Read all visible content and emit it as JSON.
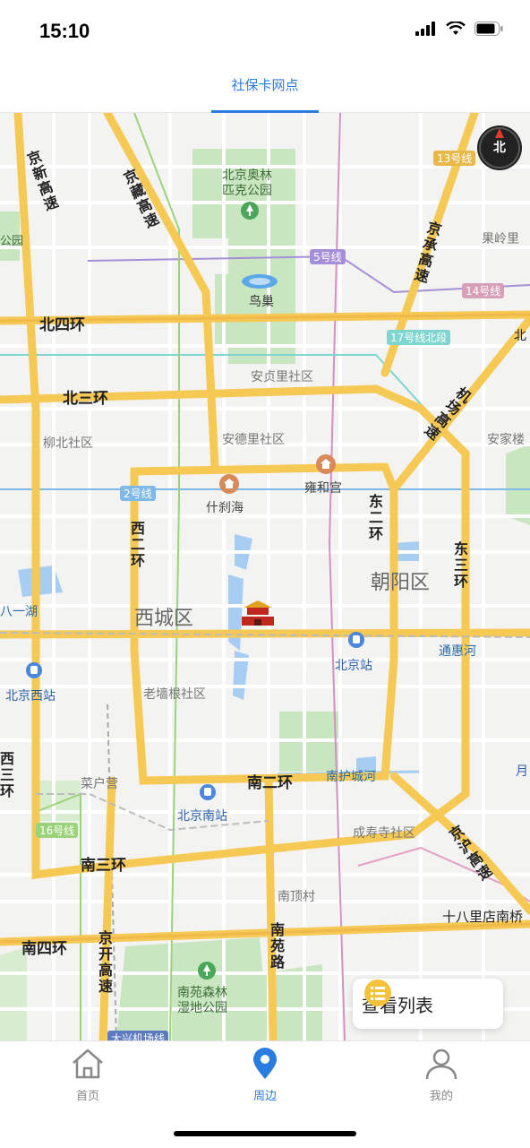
{
  "status_bar": {
    "time": "15:10"
  },
  "header": {
    "tab_label": "社保卡网点"
  },
  "map": {
    "colors": {
      "background": "#f3f3f1",
      "road_major": "#f6c955",
      "road_minor": "#ffffff",
      "park": "#c8e6c0",
      "water": "#a8cdf2"
    },
    "labels": {
      "olympic_park": "北京奥林\n匹克公园",
      "birds_nest": "鸟巢",
      "north_4th_ring": "北四环",
      "north_3rd_ring": "北三环",
      "andeli": "安德里社区",
      "anzhenli": "安贞里社区",
      "liubei": "柳北社区",
      "shichahai": "什刹海",
      "yonghegong": "雍和宫",
      "west_2nd_ring": "西二环",
      "east_2nd_ring": "东二环",
      "east_3rd_ring": "东三环",
      "xicheng": "西城区",
      "chaoyang": "朝阳区",
      "bayi_lake": "八一湖",
      "beijing_west": "北京西站",
      "beijing_station": "北京站",
      "tonghui_river": "通惠河",
      "laoqianggen": "老墙根社区",
      "caihuying": "菜户营",
      "south_2nd_ring": "南二环",
      "nanhu_river": "南护城河",
      "beijing_south": "北京南站",
      "chengshousi": "成寿寺社区",
      "south_3rd_ring": "南三环",
      "nandingcun": "南顶村",
      "nanyuan_road": "南苑路",
      "south_4th_ring": "南四环",
      "jingkai": "京开高速",
      "nanyuan_forest": "南苑森林\n湿地公园",
      "shibalidian": "十八里店南桥",
      "jinghu": "京沪高速",
      "jingxin": "京新高速",
      "jingzang": "京藏高速",
      "jingcheng": "京承高速",
      "jichang": "机场高速",
      "line_13": "13号线",
      "line_5": "5号线",
      "line_14": "14号线",
      "line_17": "17号线北段",
      "line_2": "2号线",
      "line_16": "16号线",
      "guoling": "果岭里",
      "anjia": "安家楼",
      "gongyuan": "公园",
      "bei": "北",
      "yue": "月",
      "xisanhuan": "西三环",
      "daxing": "大兴机场线",
      "nanshan": "二环",
      "xian": "线"
    },
    "compass": "北"
  },
  "list_button": {
    "label": "查看列表"
  },
  "tabbar": {
    "items": [
      {
        "label": "首页",
        "active": false
      },
      {
        "label": "周边",
        "active": true
      },
      {
        "label": "我的",
        "active": false
      }
    ],
    "active_color": "#2a7ce0",
    "inactive_color": "#888888"
  }
}
